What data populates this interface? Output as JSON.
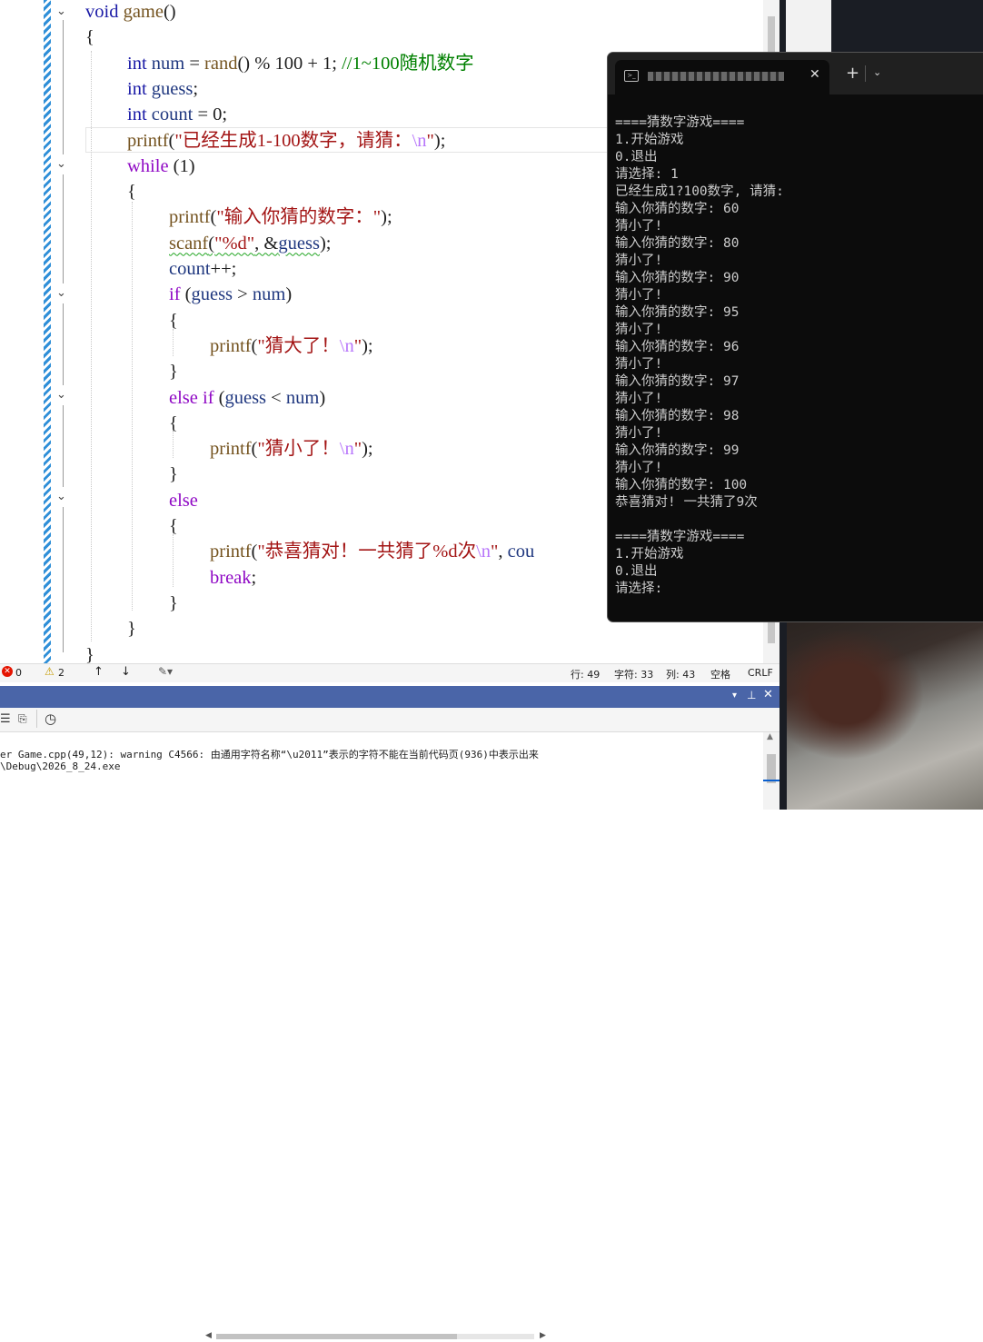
{
  "editor": {
    "lines": [
      [
        {
          "c": "kw",
          "t": "void"
        },
        {
          "c": "txt",
          "t": " "
        },
        {
          "c": "fn",
          "t": "game"
        },
        {
          "c": "txt",
          "t": "()"
        }
      ],
      [
        {
          "c": "txt",
          "t": "{"
        }
      ],
      [
        {
          "c": "kw",
          "t": "int"
        },
        {
          "c": "txt",
          "t": " "
        },
        {
          "c": "id",
          "t": "num"
        },
        {
          "c": "txt",
          "t": " = "
        },
        {
          "c": "fn",
          "t": "rand"
        },
        {
          "c": "txt",
          "t": "() % 100 + 1; "
        },
        {
          "c": "cmt",
          "t": "//1~100随机数字"
        }
      ],
      [
        {
          "c": "kw",
          "t": "int"
        },
        {
          "c": "txt",
          "t": " "
        },
        {
          "c": "id",
          "t": "guess"
        },
        {
          "c": "txt",
          "t": ";"
        }
      ],
      [
        {
          "c": "kw",
          "t": "int"
        },
        {
          "c": "txt",
          "t": " "
        },
        {
          "c": "id",
          "t": "count"
        },
        {
          "c": "txt",
          "t": " = 0;"
        }
      ],
      [
        {
          "c": "fn",
          "t": "printf"
        },
        {
          "c": "txt",
          "t": "("
        },
        {
          "c": "str",
          "t": "\"已经生成1-100数字，请猜："
        },
        {
          "c": "esc",
          "t": "\\n"
        },
        {
          "c": "str",
          "t": "\""
        },
        {
          "c": "txt",
          "t": ");"
        }
      ],
      [
        {
          "c": "pink",
          "t": "while"
        },
        {
          "c": "txt",
          "t": " (1)"
        }
      ],
      [
        {
          "c": "txt",
          "t": "{"
        }
      ],
      [
        {
          "c": "fn",
          "t": "printf"
        },
        {
          "c": "txt",
          "t": "("
        },
        {
          "c": "str",
          "t": "\"输入你猜的数字：\""
        },
        {
          "c": "txt",
          "t": ");"
        }
      ],
      [
        {
          "c": "fn",
          "t": "scanf",
          "sq": true
        },
        {
          "c": "txt",
          "t": "(",
          "sq": true
        },
        {
          "c": "str",
          "t": "\"%d\"",
          "sq": true
        },
        {
          "c": "txt",
          "t": ", &",
          "sq": true
        },
        {
          "c": "id",
          "t": "guess",
          "sq": true
        },
        {
          "c": "txt",
          "t": ");"
        }
      ],
      [
        {
          "c": "id",
          "t": "count"
        },
        {
          "c": "txt",
          "t": "++;"
        }
      ],
      [
        {
          "c": "pink",
          "t": "if"
        },
        {
          "c": "txt",
          "t": " ("
        },
        {
          "c": "id",
          "t": "guess"
        },
        {
          "c": "txt",
          "t": " > "
        },
        {
          "c": "id",
          "t": "num"
        },
        {
          "c": "txt",
          "t": ")"
        }
      ],
      [
        {
          "c": "txt",
          "t": "{"
        }
      ],
      [
        {
          "c": "fn",
          "t": "printf"
        },
        {
          "c": "txt",
          "t": "("
        },
        {
          "c": "str",
          "t": "\"猜大了！"
        },
        {
          "c": "esc",
          "t": "\\n"
        },
        {
          "c": "str",
          "t": "\""
        },
        {
          "c": "txt",
          "t": ");"
        }
      ],
      [
        {
          "c": "txt",
          "t": "}"
        }
      ],
      [
        {
          "c": "pink",
          "t": "else"
        },
        {
          "c": "txt",
          "t": " "
        },
        {
          "c": "pink",
          "t": "if"
        },
        {
          "c": "txt",
          "t": " ("
        },
        {
          "c": "id",
          "t": "guess"
        },
        {
          "c": "txt",
          "t": " < "
        },
        {
          "c": "id",
          "t": "num"
        },
        {
          "c": "txt",
          "t": ")"
        }
      ],
      [
        {
          "c": "txt",
          "t": "{"
        }
      ],
      [
        {
          "c": "fn",
          "t": "printf"
        },
        {
          "c": "txt",
          "t": "("
        },
        {
          "c": "str",
          "t": "\"猜小了！"
        },
        {
          "c": "esc",
          "t": "\\n"
        },
        {
          "c": "str",
          "t": "\""
        },
        {
          "c": "txt",
          "t": ");"
        }
      ],
      [
        {
          "c": "txt",
          "t": "}"
        }
      ],
      [
        {
          "c": "pink",
          "t": "else"
        }
      ],
      [
        {
          "c": "txt",
          "t": "{"
        }
      ],
      [
        {
          "c": "fn",
          "t": "printf"
        },
        {
          "c": "txt",
          "t": "("
        },
        {
          "c": "str",
          "t": "\"恭喜猜对！一共猜了%d次"
        },
        {
          "c": "esc",
          "t": "\\n"
        },
        {
          "c": "str",
          "t": "\""
        },
        {
          "c": "txt",
          "t": ", "
        },
        {
          "c": "id",
          "t": "cou"
        }
      ],
      [
        {
          "c": "pink",
          "t": "break"
        },
        {
          "c": "txt",
          "t": ";"
        }
      ],
      [
        {
          "c": "txt",
          "t": "}"
        }
      ],
      [
        {
          "c": "txt",
          "t": "}"
        }
      ],
      [
        {
          "c": "txt",
          "t": "}"
        }
      ]
    ]
  },
  "status": {
    "errors": "0",
    "warnings": "2",
    "line": "行: 49",
    "char": "字符: 33",
    "col": "列: 43",
    "whitespace": "空格",
    "eol": "CRLF"
  },
  "output": {
    "line1": "er Game.cpp(49,12): warning C4566: 由通用字符名称“\\u2011”表示的字符不能在当前代码页(936)中表示出来",
    "line2": "\\Debug\\2026_8_24.exe"
  },
  "terminal": {
    "tab_add": "+",
    "lines": [
      "====猜数字游戏====",
      "1.开始游戏",
      "0.退出",
      "请选择: 1",
      "已经生成1?100数字, 请猜:",
      "输入你猜的数字: 60",
      "猜小了!",
      "输入你猜的数字: 80",
      "猜小了!",
      "输入你猜的数字: 90",
      "猜小了!",
      "输入你猜的数字: 95",
      "猜小了!",
      "输入你猜的数字: 96",
      "猜小了!",
      "输入你猜的数字: 97",
      "猜小了!",
      "输入你猜的数字: 98",
      "猜小了!",
      "输入你猜的数字: 99",
      "猜小了!",
      "输入你猜的数字: 100",
      "恭喜猜对! 一共猜了9次",
      "",
      "====猜数字游戏====",
      "1.开始游戏",
      "0.退出",
      "请选择:"
    ]
  }
}
